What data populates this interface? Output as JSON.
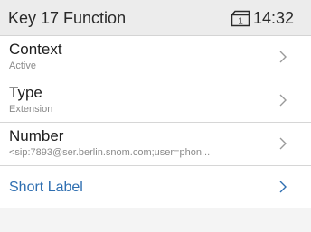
{
  "header": {
    "title": "Key 17 Function",
    "time": "14:32",
    "line_icon": "line-1-icon",
    "line_number": "1"
  },
  "menu": {
    "items": [
      {
        "label": "Context",
        "value": "Active"
      },
      {
        "label": "Type",
        "value": "Extension"
      },
      {
        "label": "Number",
        "value": "<sip:7893@ser.berlin.snom.com;user=phon..."
      },
      {
        "label": "Short Label",
        "value": ""
      }
    ]
  },
  "colors": {
    "accent": "#2f6fb1",
    "header_bg": "#ececec",
    "chevron": "#9a9a9a"
  }
}
